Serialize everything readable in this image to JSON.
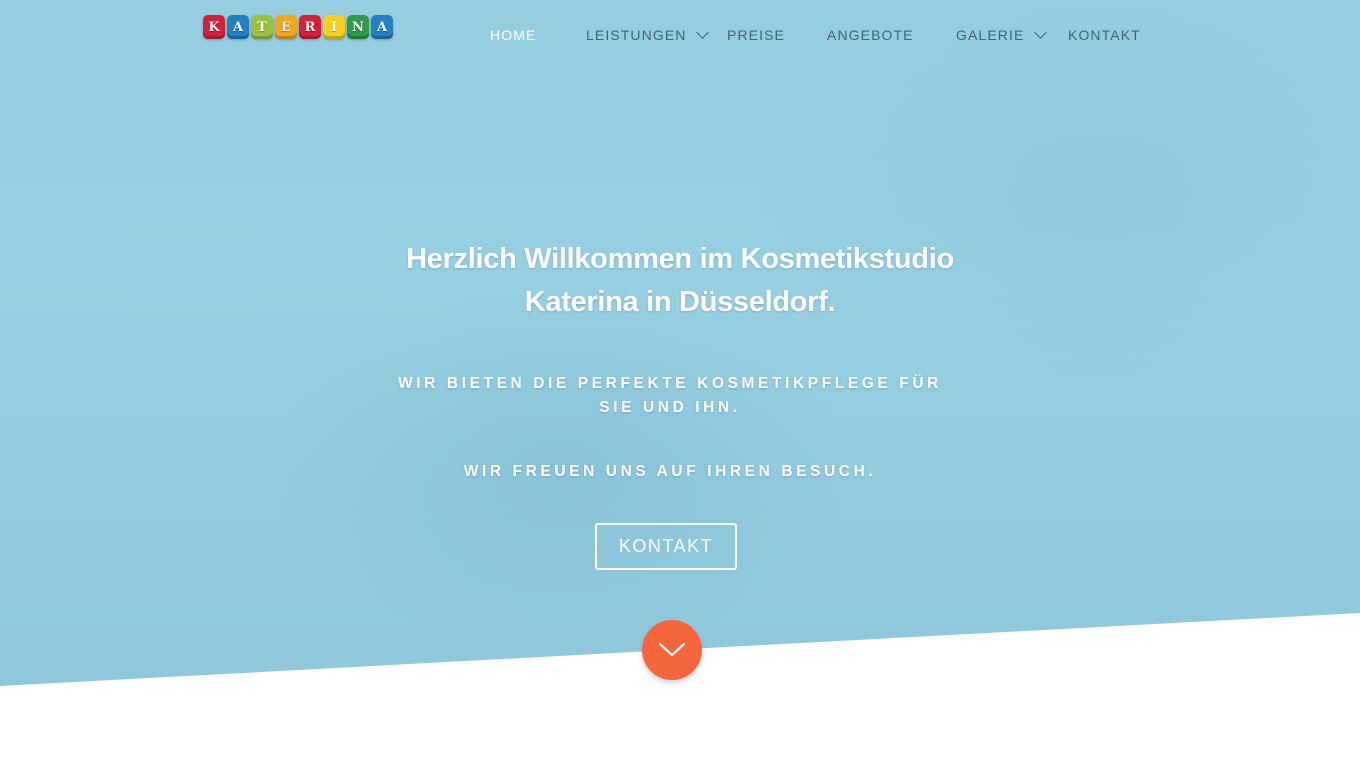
{
  "logo": {
    "letters": [
      "K",
      "A",
      "T",
      "E",
      "R",
      "I",
      "N",
      "A"
    ],
    "colors": [
      "#d41f3a",
      "#2480c2",
      "#9ac23a",
      "#f2a71b",
      "#d41f3a",
      "#f5d21e",
      "#2f9a48",
      "#2480c2"
    ]
  },
  "nav": {
    "items": [
      {
        "label": "HOME",
        "active": true,
        "dropdown": false
      },
      {
        "label": "LEISTUNGEN",
        "active": false,
        "dropdown": true
      },
      {
        "label": "PREISE",
        "active": false,
        "dropdown": false
      },
      {
        "label": "ANGEBOTE",
        "active": false,
        "dropdown": false
      },
      {
        "label": "GALERIE",
        "active": false,
        "dropdown": true
      },
      {
        "label": "KONTAKT",
        "active": false,
        "dropdown": false
      }
    ]
  },
  "hero": {
    "headline_line1": "Herzlich Willkommen im Kosmetikstudio",
    "headline_line2": "Katerina in Düsseldorf.",
    "subline1": "WIR BIETEN DIE PERFEKTE KOSMETIKPFLEGE FÜR SIE UND IHN.",
    "subline2": "WIR FREUEN UNS AUF IHREN BESUCH.",
    "cta_label": "KONTAKT",
    "scroll_icon": "chevron-down-icon"
  },
  "colors": {
    "accent": "#f5663e",
    "hero_bg": "#96cde1",
    "nav_text": "#3f6478"
  }
}
